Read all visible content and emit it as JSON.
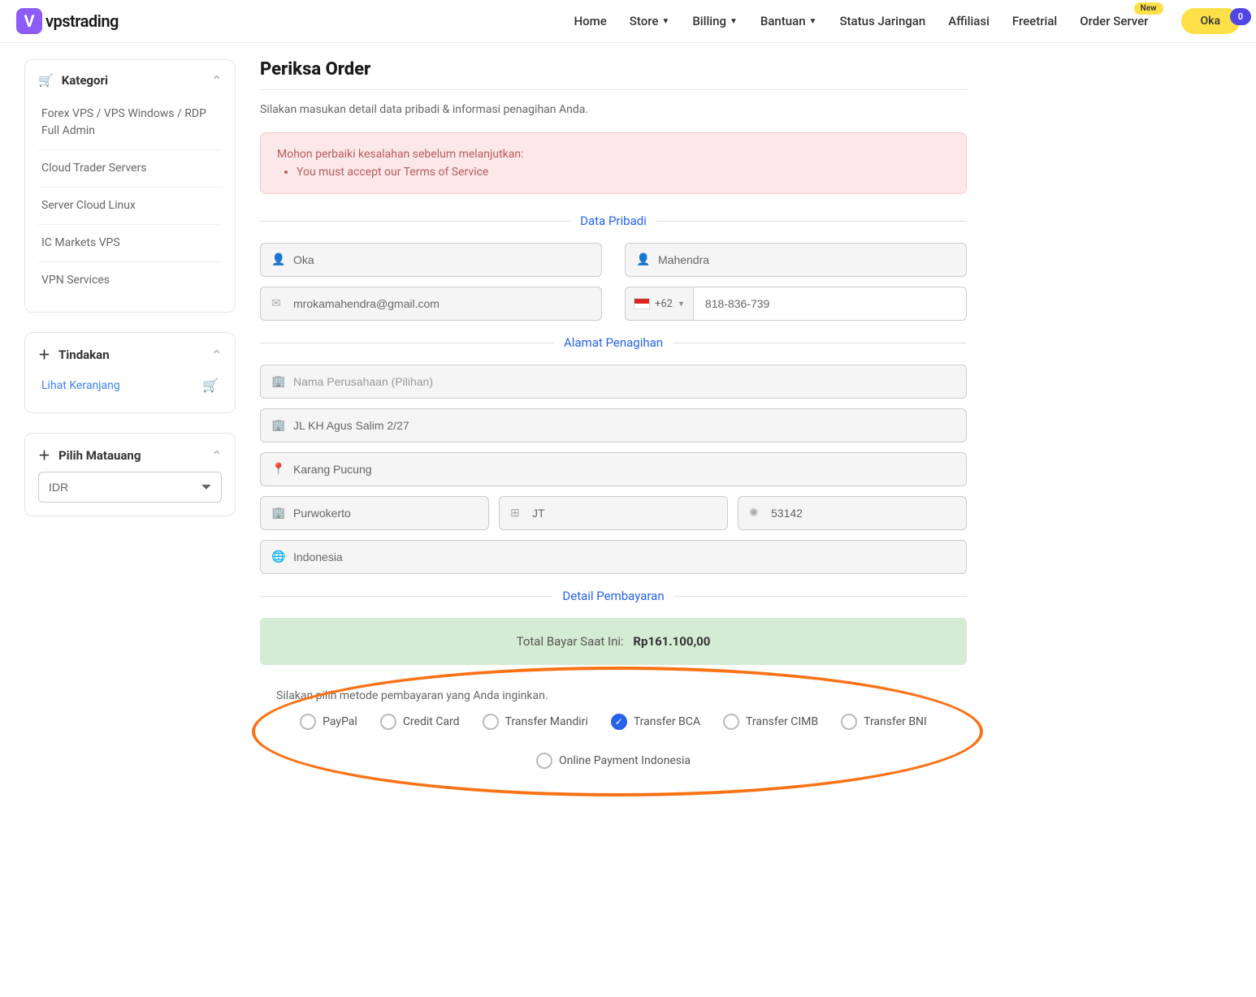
{
  "logo": "vpstrading",
  "nav": {
    "home": "Home",
    "store": "Store",
    "billing": "Billing",
    "bantuan": "Bantuan",
    "status": "Status Jaringan",
    "affiliasi": "Affiliasi",
    "freetrial": "Freetrial",
    "order": "Order Server",
    "new_badge": "New"
  },
  "user": "Oka",
  "cart_count": "0",
  "sidebar": {
    "kategori_title": "Kategori",
    "categories": [
      "Forex VPS / VPS Windows / RDP Full Admin",
      "Cloud Trader Servers",
      "Server Cloud Linux",
      "IC Markets VPS",
      "VPN Services"
    ],
    "tindakan_title": "Tindakan",
    "lihat_keranjang": "Lihat Keranjang",
    "matauang_title": "Pilih Matauang",
    "currency": "IDR"
  },
  "main": {
    "title": "Periksa Order",
    "subtitle": "Silakan masukan detail data pribadi & informasi penagihan Anda.",
    "alert_title": "Mohon perbaiki kesalahan sebelum melanjutkan:",
    "alert_item": "You must accept our Terms of Service",
    "section_personal": "Data Pribadi",
    "section_billing": "Alamat Penagihan",
    "section_payment": "Detail Pembayaran",
    "first_name": "Oka",
    "last_name": "Mahendra",
    "email": "mrokamahendra@gmail.com",
    "phone_code": "+62",
    "phone": "818-836-739",
    "company_placeholder": "Nama Perusahaan (Pilihan)",
    "address": "JL KH Agus Salim 2/27",
    "city": "Karang Pucung",
    "district": "Purwokerto",
    "state": "JT",
    "postal": "53142",
    "country": "Indonesia",
    "total_label": "Total Bayar Saat Ini:",
    "total_amount": "Rp161.100,00",
    "payment_label": "Silakan pilih metode pembayaran yang Anda inginkan.",
    "payments": {
      "paypal": "PayPal",
      "credit": "Credit Card",
      "mandiri": "Transfer Mandiri",
      "bca": "Transfer BCA",
      "cimb": "Transfer CIMB",
      "bni": "Transfer BNI",
      "online": "Online Payment Indonesia"
    }
  }
}
